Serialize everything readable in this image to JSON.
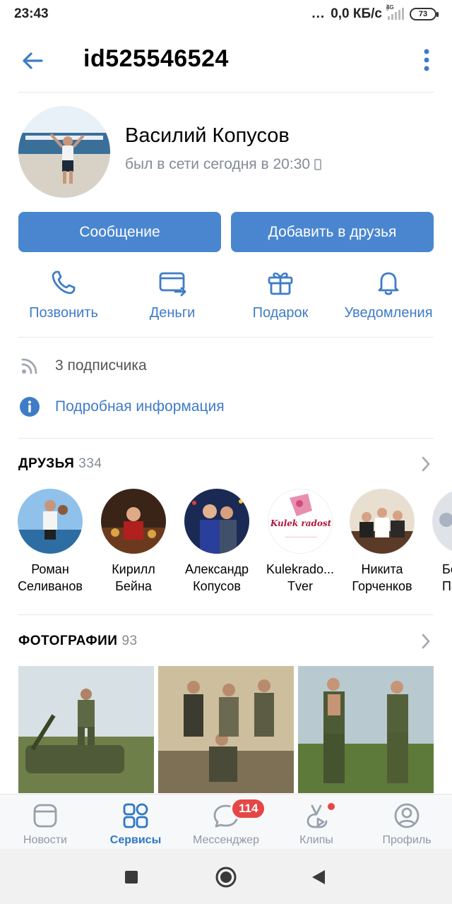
{
  "status_bar": {
    "time": "23:43",
    "dots": "...",
    "speed": "0,0 КБ/с",
    "network": "4G",
    "battery": "73"
  },
  "header": {
    "title": "id525546524"
  },
  "profile": {
    "name": "Василий Копусов",
    "last_seen": "был в сети сегодня в 20:30"
  },
  "buttons": {
    "message": "Сообщение",
    "add_friend": "Добавить в друзья"
  },
  "actions": [
    {
      "label": "Позвонить",
      "icon": "phone-icon"
    },
    {
      "label": "Деньги",
      "icon": "money-transfer-icon"
    },
    {
      "label": "Подарок",
      "icon": "gift-icon"
    },
    {
      "label": "Уведомления",
      "icon": "bell-icon"
    }
  ],
  "info": {
    "followers": "3 подписчика",
    "details": "Подробная информация"
  },
  "friends_section": {
    "title": "ДРУЗЬЯ",
    "count": "334",
    "items": [
      {
        "first": "Роман",
        "last": "Селиванов"
      },
      {
        "first": "Кирилл",
        "last": "Бейна"
      },
      {
        "first": "Александр",
        "last": "Копусов"
      },
      {
        "first": "Kulekrado...",
        "last": "Tver"
      },
      {
        "first": "Никита",
        "last": "Горченков"
      },
      {
        "first": "Бо",
        "last": "Па"
      }
    ]
  },
  "photos_section": {
    "title": "ФОТОГРАФИИ",
    "count": "93"
  },
  "bottom_nav": {
    "items": [
      {
        "label": "Новости",
        "icon": "news-icon"
      },
      {
        "label": "Сервисы",
        "icon": "services-icon",
        "active": true
      },
      {
        "label": "Мессенджер",
        "icon": "messenger-icon",
        "badge": "114"
      },
      {
        "label": "Клипы",
        "icon": "clips-icon"
      },
      {
        "label": "Профиль",
        "icon": "profile-icon"
      }
    ]
  },
  "colors": {
    "accent": "#4a86d0",
    "link": "#3e7cc7",
    "badge": "#e64646"
  }
}
